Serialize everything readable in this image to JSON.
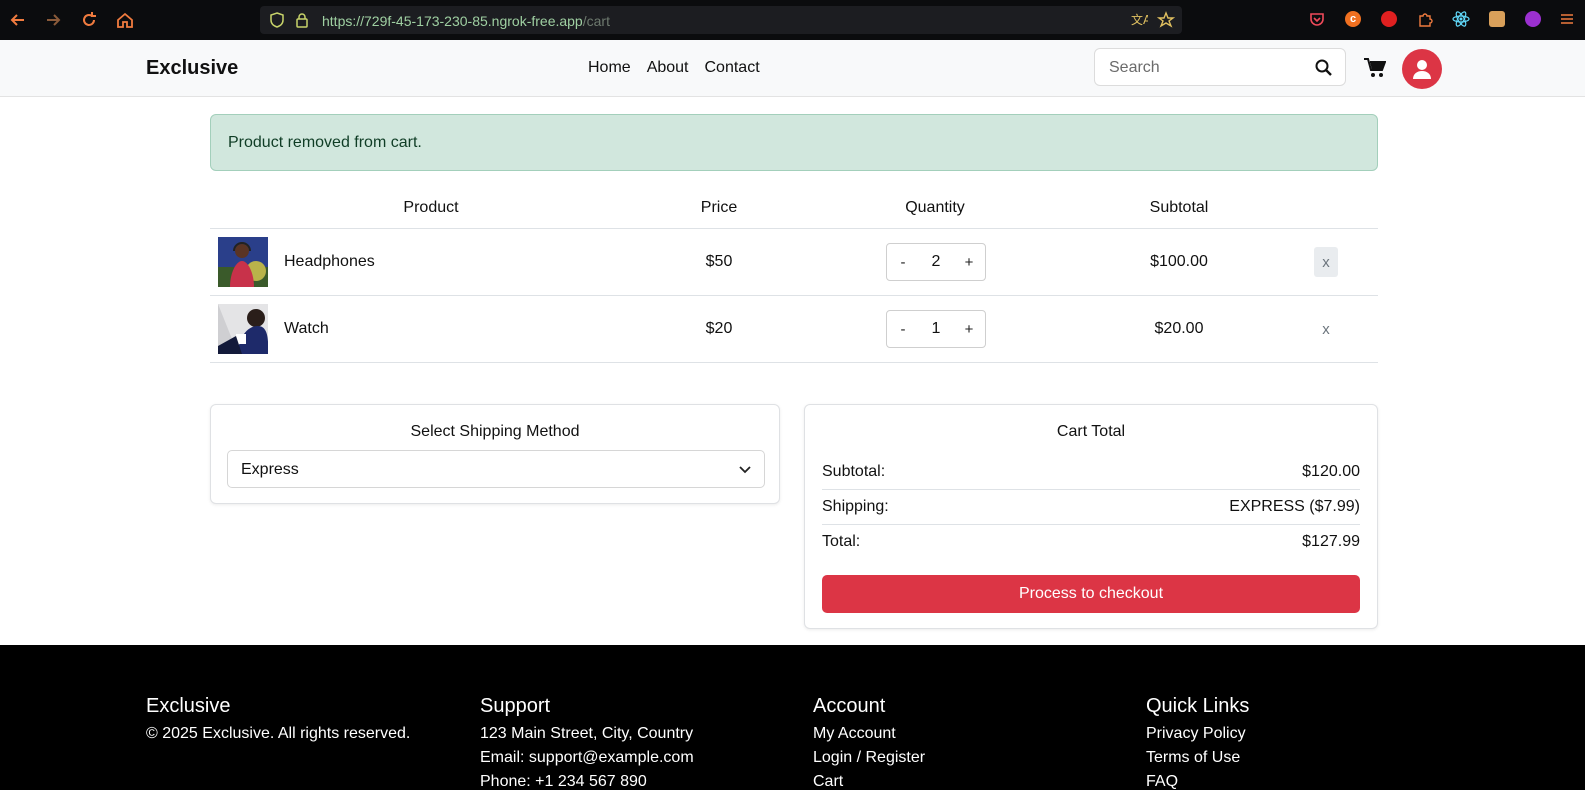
{
  "browser": {
    "url_host": "https://729f-45-173-230-85.ngrok-free.app",
    "url_path": "/cart"
  },
  "header": {
    "brand": "Exclusive",
    "nav": [
      "Home",
      "About",
      "Contact"
    ],
    "search_placeholder": "Search"
  },
  "alert": {
    "message": "Product removed from cart."
  },
  "cart": {
    "columns": [
      "Product",
      "Price",
      "Quantity",
      "Subtotal"
    ],
    "rows": [
      {
        "name": "Headphones",
        "price": "$50",
        "quantity": "2",
        "subtotal": "$100.00",
        "remove": "x"
      },
      {
        "name": "Watch",
        "price": "$20",
        "quantity": "1",
        "subtotal": "$20.00",
        "remove": "x"
      }
    ],
    "minus": "-",
    "plus": "+"
  },
  "shipping": {
    "title": "Select Shipping Method",
    "selected": "Express"
  },
  "totals": {
    "title": "Cart Total",
    "subtotal_label": "Subtotal:",
    "subtotal_value": "$120.00",
    "shipping_label": "Shipping:",
    "shipping_value": "EXPRESS ($7.99)",
    "total_label": "Total:",
    "total_value": "$127.99",
    "checkout_label": "Process to checkout"
  },
  "footer": {
    "brand": {
      "title": "Exclusive",
      "lines": [
        "© 2025 Exclusive. All rights reserved."
      ]
    },
    "support": {
      "title": "Support",
      "lines": [
        "123 Main Street, City, Country",
        "Email: support@example.com",
        "Phone: +1 234 567 890"
      ]
    },
    "account": {
      "title": "Account",
      "lines": [
        "My Account",
        "Login / Register",
        "Cart"
      ]
    },
    "quick_links": {
      "title": "Quick Links",
      "lines": [
        "Privacy Policy",
        "Terms of Use",
        "FAQ"
      ]
    }
  },
  "colors": {
    "accent": "#dc3545",
    "alert_bg": "#d1e7dd",
    "footer_bg": "#000000"
  }
}
